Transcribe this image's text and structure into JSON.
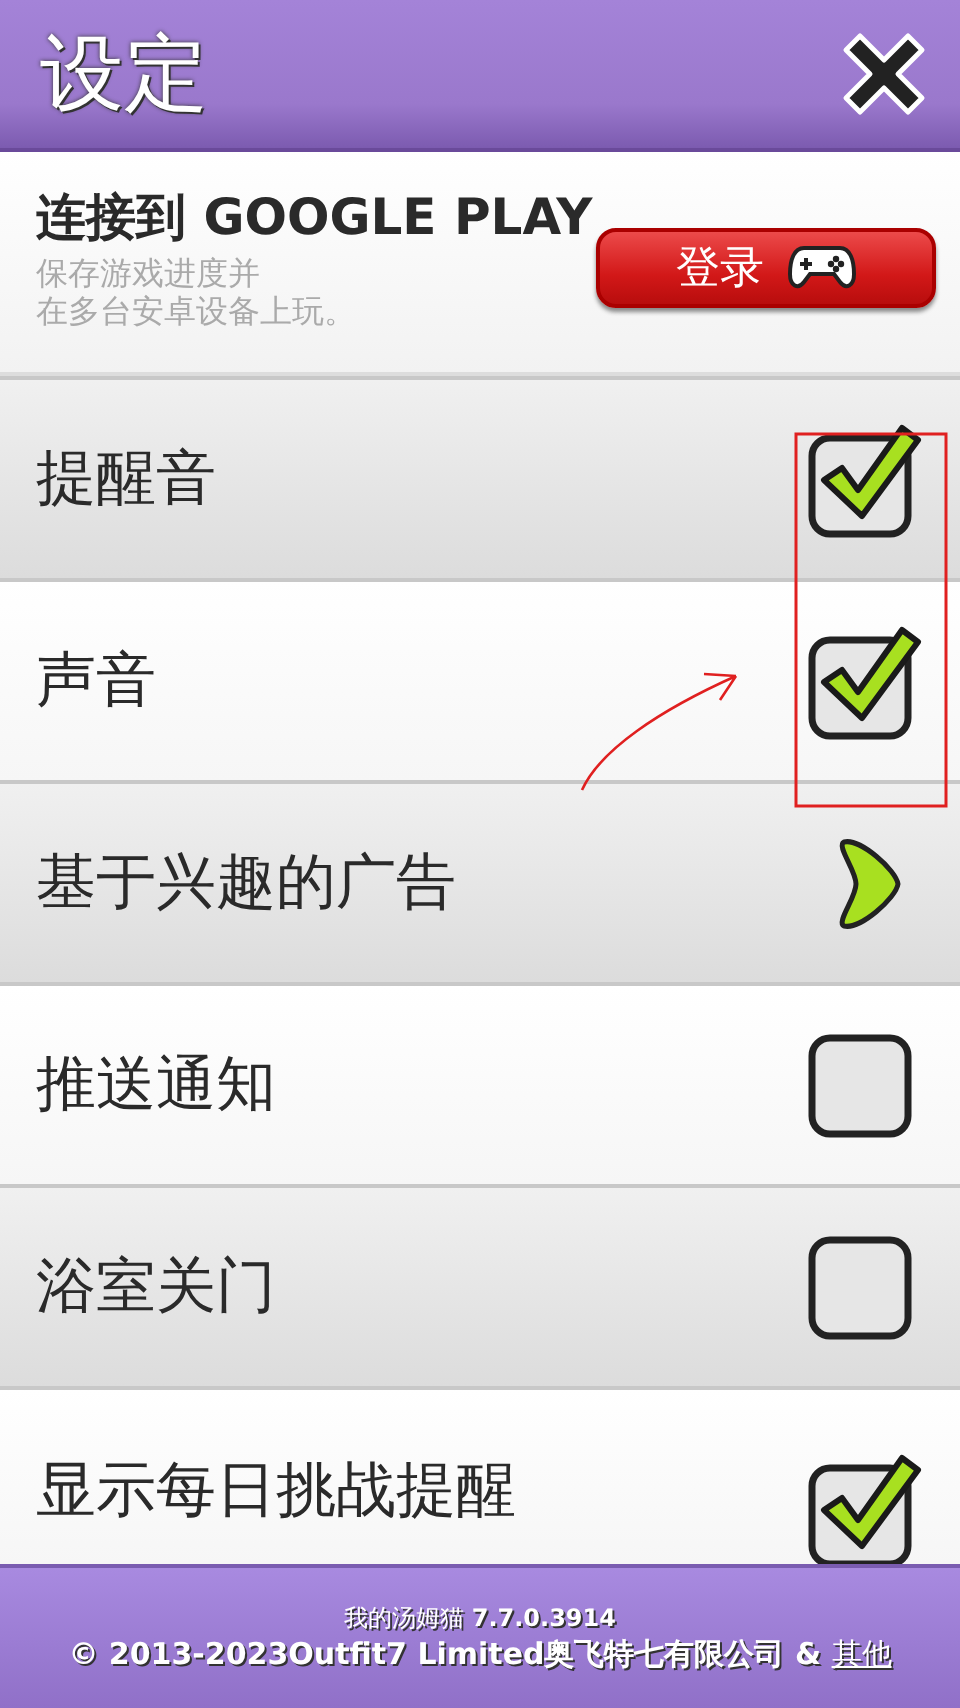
{
  "header": {
    "title": "设定"
  },
  "google_play": {
    "title": "连接到 GOOGLE PLAY",
    "description": [
      "保存游戏进度并",
      "在多台安卓设备上玩。"
    ],
    "button": "登录"
  },
  "settings": [
    {
      "kind": "checkbox",
      "label": "提醒音",
      "checked": true
    },
    {
      "kind": "checkbox",
      "label": "声音",
      "checked": true
    },
    {
      "kind": "link",
      "label": "基于兴趣的广告"
    },
    {
      "kind": "checkbox",
      "label": "推送通知",
      "checked": false
    },
    {
      "kind": "checkbox",
      "label": "浴室关门",
      "checked": false
    },
    {
      "kind": "checkbox",
      "label": "显示每日挑战提醒",
      "checked": true
    }
  ],
  "footer": {
    "version": "我的汤姆猫 **7.7.0.3914**",
    "copyright": "© 2013-2023Outfit7 Limited奥飞特七有限公司 & ",
    "link": "其他"
  },
  "annotation": {
    "highlight_box": {
      "color": "#e02020"
    },
    "arrow": {
      "color": "#e02020"
    }
  }
}
